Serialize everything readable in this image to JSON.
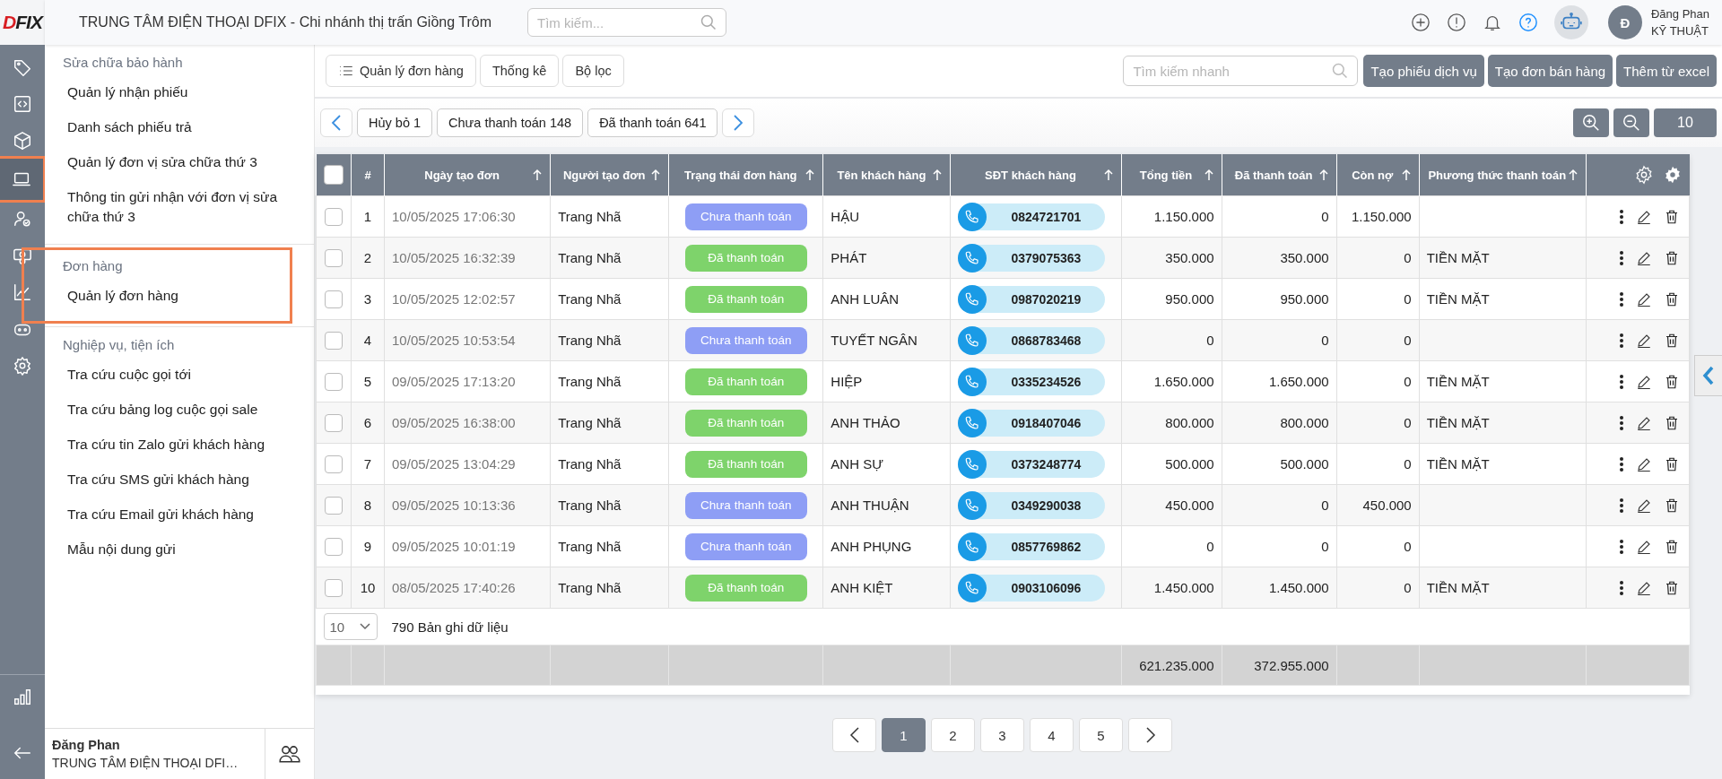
{
  "rail": {
    "logo": [
      "D",
      "FIX"
    ],
    "items": [
      {
        "highlighted": false
      },
      {
        "highlighted": false
      },
      {
        "highlighted": false
      },
      {
        "highlighted": true
      },
      {
        "highlighted": false
      },
      {
        "highlighted": false
      },
      {
        "highlighted": false
      },
      {
        "highlighted": false
      },
      {
        "highlighted": false
      }
    ]
  },
  "header": {
    "title": "TRUNG TÂM ĐIỆN THOẠI DFIX - Chi nhánh thị trấn Giồng Trôm",
    "search": {
      "placeholder": "Tìm kiếm..."
    },
    "avatar": "Đ",
    "user_name": "Đăng Phan",
    "user_role": "KỸ THUẬT"
  },
  "sidebar": {
    "sections": [
      {
        "title": "Sửa chữa bảo hành",
        "highlighted": false,
        "items": [
          {
            "label": "Quản lý nhận phiếu"
          },
          {
            "label": "Danh sách phiếu trả"
          },
          {
            "label": "Quản lý đơn vị sửa chữa thứ 3"
          },
          {
            "label": "Thông tin gửi nhận với đơn vị sửa chữa thứ 3"
          }
        ]
      },
      {
        "title": "Đơn hàng",
        "highlighted": true,
        "items": [
          {
            "label": "Quản lý đơn hàng"
          }
        ]
      },
      {
        "title": "Nghiệp vụ, tiện ích",
        "highlighted": false,
        "items": [
          {
            "label": "Tra cứu cuộc gọi tới"
          },
          {
            "label": "Tra cứu bảng log cuộc gọi sale"
          },
          {
            "label": "Tra cứu tin Zalo gửi khách hàng"
          },
          {
            "label": "Tra cứu SMS gửi khách hàng"
          },
          {
            "label": "Tra cứu Email gửi khách hàng"
          },
          {
            "label": "Mẫu nội dung gửi"
          }
        ]
      }
    ],
    "footer": {
      "name": "Đăng Phan",
      "org": "TRUNG TÂM ĐIỆN THOẠI DFI…"
    }
  },
  "toolbar": {
    "tabs": [
      "Quản lý đơn hàng",
      "Thống kê",
      "Bộ lọc"
    ],
    "search": {
      "placeholder": "Tìm kiếm nhanh"
    },
    "buttons": [
      "Tạo phiếu dịch vụ",
      "Tạo đơn bán hàng",
      "Thêm từ excel"
    ]
  },
  "filters": {
    "chips": [
      "Hủy bỏ 1",
      "Chưa thanh toán 148",
      "Đã thanh toán 641"
    ],
    "zoom_value": "10"
  },
  "table": {
    "select_all": {
      "checked": false
    },
    "columns": [
      {
        "label": "#",
        "sortable": false
      },
      {
        "label": "Ngày tạo đơn",
        "sortable": true
      },
      {
        "label": "Người tạo đơn",
        "sortable": true
      },
      {
        "label": "Trạng thái đơn hàng",
        "sortable": true
      },
      {
        "label": "Tên khách hàng",
        "sortable": true
      },
      {
        "label": "SĐT khách hàng",
        "sortable": true
      },
      {
        "label": "Tổng tiền",
        "sortable": true
      },
      {
        "label": "Đã thanh toán",
        "sortable": true
      },
      {
        "label": "Còn nợ",
        "sortable": true
      },
      {
        "label": "Phương thức thanh toán",
        "sortable": true
      }
    ],
    "rows": [
      {
        "checked": false,
        "no": "1",
        "date": "10/05/2025 17:06:30",
        "creator": "Trang Nhã",
        "status": "Chưa thanh toán",
        "kind": "unpaid",
        "customer": "HẬU",
        "phone": "0824721701",
        "total": "1.150.000",
        "paid": "0",
        "debt": "1.150.000"
      },
      {
        "checked": false,
        "no": "2",
        "date": "10/05/2025 16:32:39",
        "creator": "Trang Nhã",
        "status": "Đã thanh toán",
        "kind": "paid",
        "customer": "PHÁT",
        "phone": "0379075363",
        "total": "350.000",
        "paid": "350.000",
        "debt": "0",
        "method": "TIỀN MẶT"
      },
      {
        "checked": false,
        "no": "3",
        "date": "10/05/2025 12:02:57",
        "creator": "Trang Nhã",
        "status": "Đã thanh toán",
        "kind": "paid",
        "customer": "ANH LUÂN",
        "phone": "0987020219",
        "total": "950.000",
        "paid": "950.000",
        "debt": "0",
        "method": "TIỀN MẶT"
      },
      {
        "checked": false,
        "no": "4",
        "date": "10/05/2025 10:53:54",
        "creator": "Trang Nhã",
        "status": "Chưa thanh toán",
        "kind": "unpaid",
        "customer": "TUYẾT NGÂN",
        "phone": "0868783468",
        "total": "0",
        "paid": "0",
        "debt": "0"
      },
      {
        "checked": false,
        "no": "5",
        "date": "09/05/2025 17:13:20",
        "creator": "Trang Nhã",
        "status": "Đã thanh toán",
        "kind": "paid",
        "customer": "HIỆP",
        "phone": "0335234526",
        "total": "1.650.000",
        "paid": "1.650.000",
        "debt": "0",
        "method": "TIỀN MẶT"
      },
      {
        "checked": false,
        "no": "6",
        "date": "09/05/2025 16:38:00",
        "creator": "Trang Nhã",
        "status": "Đã thanh toán",
        "kind": "paid",
        "customer": "ANH THẢO",
        "phone": "0918407046",
        "total": "800.000",
        "paid": "800.000",
        "debt": "0",
        "method": "TIỀN MẶT"
      },
      {
        "checked": false,
        "no": "7",
        "date": "09/05/2025 13:04:29",
        "creator": "Trang Nhã",
        "status": "Đã thanh toán",
        "kind": "paid",
        "customer": "ANH SỰ",
        "phone": "0373248774",
        "total": "500.000",
        "paid": "500.000",
        "debt": "0",
        "method": "TIỀN MẶT"
      },
      {
        "checked": false,
        "no": "8",
        "date": "09/05/2025 10:13:36",
        "creator": "Trang Nhã",
        "status": "Chưa thanh toán",
        "kind": "unpaid",
        "customer": "ANH THUẬN",
        "phone": "0349290038",
        "total": "450.000",
        "paid": "0",
        "debt": "450.000"
      },
      {
        "checked": false,
        "no": "9",
        "date": "09/05/2025 10:01:19",
        "creator": "Trang Nhã",
        "status": "Chưa thanh toán",
        "kind": "unpaid",
        "customer": "ANH PHỤNG",
        "phone": "0857769862",
        "total": "0",
        "paid": "0",
        "debt": "0"
      },
      {
        "checked": false,
        "no": "10",
        "date": "08/05/2025 17:40:26",
        "creator": "Trang Nhã",
        "status": "Đã thanh toán",
        "kind": "paid",
        "customer": "ANH KIỆT",
        "phone": "0903106096",
        "total": "1.450.000",
        "paid": "1.450.000",
        "debt": "0",
        "method": "TIỀN MẶT"
      }
    ],
    "page_size": "10",
    "record_count": "790 Bản ghi dữ liệu",
    "totals": {
      "total": "621.235.000",
      "paid": "372.955.000"
    }
  },
  "pagination": {
    "pages": [
      {
        "label": "1",
        "selected": true
      },
      {
        "label": "2",
        "selected": false
      },
      {
        "label": "3",
        "selected": false
      },
      {
        "label": "4",
        "selected": false
      },
      {
        "label": "5",
        "selected": false
      }
    ]
  }
}
